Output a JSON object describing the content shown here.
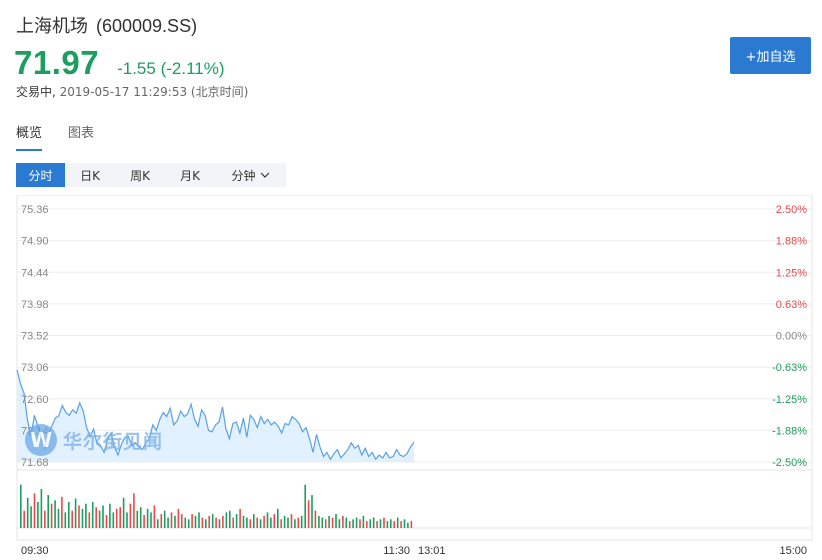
{
  "header": {
    "stock_name": "上海机场",
    "stock_code": "(600009.SS)",
    "price": "71.97",
    "change": "-1.55 (-2.11%)",
    "status": "交易中,",
    "timestamp": "2019-05-17 11:29:53 (北京时间)",
    "add_button": "+加自选"
  },
  "tabs": [
    {
      "label": "概览",
      "active": true
    },
    {
      "label": "图表",
      "active": false
    }
  ],
  "periods": [
    {
      "label": "分时",
      "active": true
    },
    {
      "label": "日K",
      "active": false
    },
    {
      "label": "周K",
      "active": false
    },
    {
      "label": "月K",
      "active": false
    },
    {
      "label": "分钟",
      "active": false
    }
  ],
  "watermark": {
    "logo": "W",
    "text": "华尔街见闻"
  },
  "colors": {
    "up": "#e84a4a",
    "down": "#1d9d5f",
    "accent": "#2a7ad2",
    "line": "#5aa0e8",
    "fill": "#ddeeff"
  },
  "icons": {
    "period_dropdown": "chevron-down-icon"
  },
  "chart_data": {
    "type": "line",
    "title": "",
    "price_axis_ticks": [
      "75.36",
      "74.90",
      "74.44",
      "73.98",
      "73.52",
      "73.06",
      "72.60",
      "72.14",
      "71.68"
    ],
    "percent_axis_ticks": [
      "2.50%",
      "1.88%",
      "1.25%",
      "0.63%",
      "0.00%",
      "-0.63%",
      "-1.25%",
      "-1.88%",
      "-2.50%"
    ],
    "ylim": [
      71.68,
      75.36
    ],
    "prev_close": 73.52,
    "time_ticks": [
      "09:30",
      "11:30",
      "13:01",
      "15:00"
    ],
    "price_series": [
      73.02,
      72.82,
      72.68,
      72.3,
      72.05,
      72.36,
      72.2,
      72.02,
      71.88,
      72.1,
      72.2,
      72.32,
      72.35,
      72.5,
      72.4,
      72.36,
      72.44,
      72.39,
      72.54,
      72.42,
      72.18,
      72.05,
      72.16,
      71.94,
      71.92,
      71.82,
      72.0,
      72.1,
      71.9,
      71.78,
      71.94,
      72.04,
      72.05,
      71.92,
      71.96,
      71.9,
      71.86,
      71.96,
      72.02,
      72.22,
      72.14,
      72.3,
      72.4,
      72.34,
      72.46,
      72.22,
      72.28,
      72.42,
      72.34,
      72.38,
      72.52,
      72.3,
      72.2,
      72.44,
      72.36,
      72.14,
      72.12,
      72.22,
      72.26,
      72.48,
      72.16,
      72.02,
      72.24,
      72.26,
      72.1,
      72.32,
      72.04,
      72.36,
      72.3,
      72.18,
      72.34,
      72.24,
      72.3,
      72.22,
      72.26,
      72.2,
      72.1,
      72.24,
      72.22,
      72.34,
      72.3,
      72.24,
      72.12,
      72.18,
      72.02,
      71.82,
      72.08,
      71.9,
      71.76,
      71.82,
      71.72,
      71.8,
      71.86,
      71.74,
      71.8,
      71.86,
      71.96,
      71.88,
      71.92,
      71.78,
      71.88,
      71.76,
      71.82,
      71.72,
      71.78,
      71.74,
      71.82,
      71.74,
      71.76,
      71.86,
      71.78,
      71.76,
      71.8,
      71.9,
      71.97
    ],
    "volume_series": [
      50,
      20,
      35,
      25,
      40,
      30,
      45,
      20,
      38,
      28,
      32,
      22,
      36,
      18,
      30,
      20,
      34,
      26,
      22,
      28,
      18,
      30,
      24,
      20,
      26,
      15,
      28,
      18,
      22,
      24,
      35,
      18,
      28,
      40,
      20,
      24,
      15,
      22,
      18,
      26,
      10,
      16,
      20,
      12,
      18,
      14,
      22,
      16,
      12,
      10,
      16,
      14,
      18,
      12,
      10,
      14,
      16,
      12,
      10,
      14,
      18,
      20,
      12,
      16,
      22,
      14,
      12,
      10,
      16,
      12,
      10,
      14,
      18,
      12,
      16,
      22,
      10,
      14,
      12,
      16,
      10,
      12,
      14,
      50,
      32,
      38,
      20,
      14,
      12,
      10,
      14,
      12,
      16,
      10,
      14,
      12,
      8,
      10,
      12,
      10,
      14,
      8,
      10,
      12,
      8,
      10,
      12,
      8,
      10,
      8,
      12,
      8,
      10,
      6,
      8
    ],
    "volume_colors": [
      "g",
      "r",
      "g",
      "g",
      "r",
      "g",
      "g",
      "r",
      "g",
      "r",
      "g",
      "g",
      "r",
      "g",
      "g",
      "r",
      "g",
      "r",
      "g",
      "g",
      "r",
      "g",
      "r",
      "g",
      "g",
      "r",
      "g",
      "g",
      "r",
      "r",
      "g",
      "g",
      "r",
      "r",
      "g",
      "g",
      "r",
      "g",
      "g",
      "r",
      "g",
      "r",
      "g",
      "g",
      "r",
      "g",
      "r",
      "r",
      "g",
      "g",
      "r",
      "g",
      "g",
      "r",
      "g",
      "r",
      "g",
      "r",
      "g",
      "r",
      "g",
      "g",
      "r",
      "g",
      "r",
      "g",
      "g",
      "r",
      "g",
      "r",
      "g",
      "r",
      "g",
      "g",
      "r",
      "g",
      "r",
      "g",
      "g",
      "r",
      "g",
      "r",
      "g",
      "g",
      "r",
      "g",
      "r",
      "g",
      "g",
      "r",
      "g",
      "r",
      "g",
      "g",
      "r",
      "g",
      "r",
      "g",
      "g",
      "r",
      "g",
      "r",
      "g",
      "g",
      "r",
      "g",
      "r",
      "g",
      "g",
      "r",
      "g",
      "r",
      "g",
      "g",
      "r"
    ],
    "volume_max": 60,
    "grid": true
  }
}
